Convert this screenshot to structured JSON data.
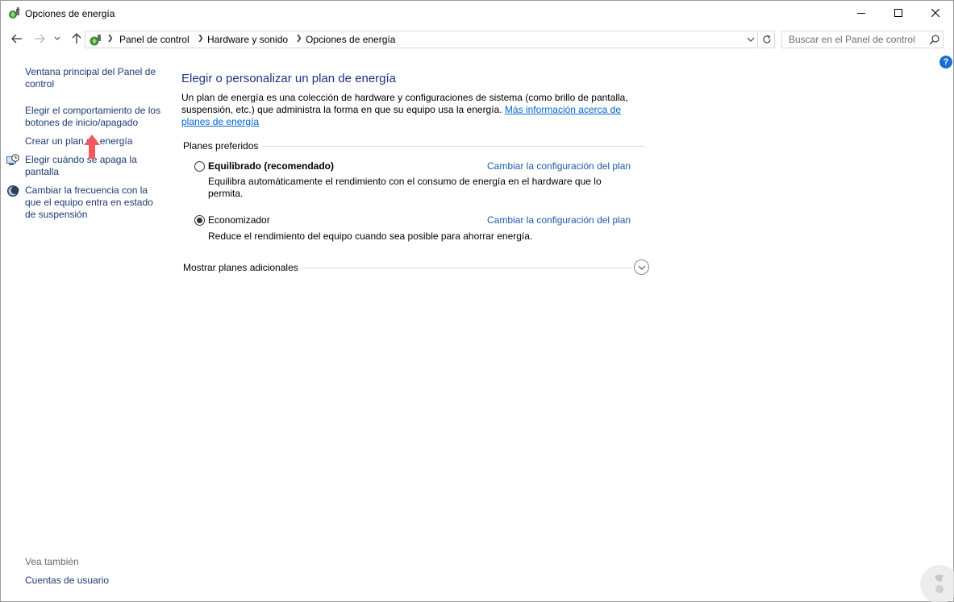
{
  "window": {
    "title": "Opciones de energía",
    "controls": {
      "minimize": "minimize-icon",
      "maximize": "maximize-icon",
      "close": "close-icon"
    }
  },
  "nav": {
    "breadcrumb": [
      "Panel de control",
      "Hardware y sonido",
      "Opciones de energía"
    ],
    "search_placeholder": "Buscar en el Panel de control",
    "icons": [
      "back-arrow-icon",
      "forward-arrow-icon",
      "chevron-down-icon",
      "up-arrow-icon",
      "refresh-icon",
      "search-icon",
      "help-icon"
    ]
  },
  "sidebar": {
    "items": [
      {
        "label": "Ventana principal del Panel de control"
      },
      {
        "label": "Elegir el comportamiento de los botones de inicio/apagado"
      },
      {
        "label": "Crear un plan de energía"
      },
      {
        "label": "Elegir cuándo se apaga la pantalla",
        "icon": "display-clock-icon"
      },
      {
        "label": "Cambiar la frecuencia con la que el equipo entra en estado de suspensión",
        "icon": "moon-sleep-icon"
      }
    ],
    "see_also_title": "Vea también",
    "see_also_items": [
      "Cuentas de usuario"
    ]
  },
  "main": {
    "title": "Elegir o personalizar un plan de energía",
    "description": "Un plan de energía es una colección de hardware y configuraciones de sistema (como brillo de pantalla, suspensión, etc.) que administra la forma en que su equipo usa la energía.",
    "description_link": "Más información acerca de planes de energía",
    "preferred_label": "Planes preferidos",
    "plans": [
      {
        "name": "Equilibrado (recomendado)",
        "description": "Equilibra automáticamente el rendimiento con el consumo de energía en el hardware que lo permita.",
        "link": "Cambiar la configuración del plan",
        "selected": false
      },
      {
        "name": "Economizador",
        "description": "Reduce el rendimiento del equipo cuando sea posible para ahorrar energía.",
        "link": "Cambiar la configuración del plan",
        "selected": true
      }
    ],
    "more_plans_label": "Mostrar planes adicionales"
  },
  "colors": {
    "title_blue": "#1e3287",
    "link_blue": "#1c5bad",
    "nav_link": "#1a3a73",
    "annotation_arrow": "#f0595d"
  }
}
